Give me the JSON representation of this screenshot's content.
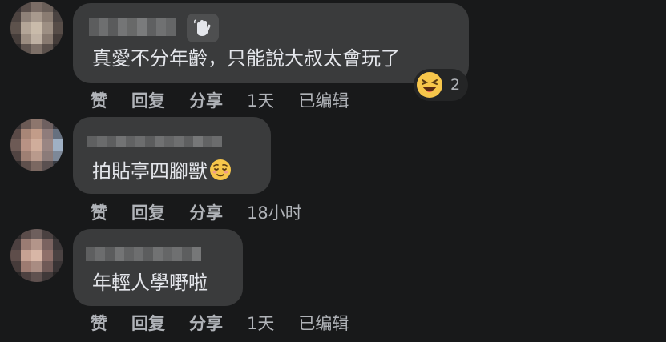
{
  "comments": [
    {
      "text": "真愛不分年齡，只能說大叔太會玩了",
      "actions": {
        "like": "赞",
        "reply": "回复",
        "share": "分享"
      },
      "time": "1天",
      "edited": "已编辑",
      "reaction": {
        "icon": "laughing-emoji-icon",
        "count": "2"
      },
      "badge_icon": "wave-hand-icon"
    },
    {
      "text": "拍貼亭四腳獸",
      "inline_emoji": "relieved-face-emoji-icon",
      "actions": {
        "like": "赞",
        "reply": "回复",
        "share": "分享"
      },
      "time": "18小时"
    },
    {
      "text": "年輕人學嘢啦",
      "actions": {
        "like": "赞",
        "reply": "回复",
        "share": "分享"
      },
      "time": "1天",
      "edited": "已编辑"
    }
  ],
  "colors": {
    "background": "#18191a",
    "bubble": "#3a3b3c",
    "text": "#e4e6eb",
    "secondary_text": "#b0b3b8"
  }
}
